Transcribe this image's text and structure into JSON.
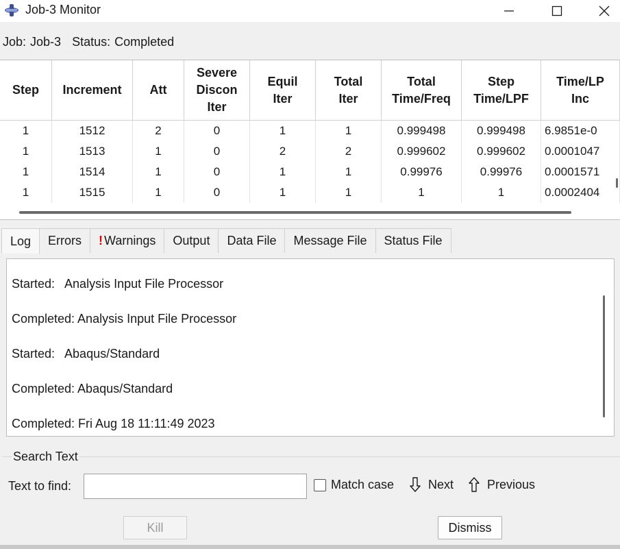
{
  "window": {
    "title": "Job-3 Monitor"
  },
  "job_line": {
    "job_label": "Job:",
    "job_value": "Job-3",
    "status_label": "Status:",
    "status_value": "Completed"
  },
  "table": {
    "headers": [
      "Step",
      "Increment",
      "Att",
      "Severe\nDiscon\nIter",
      "Equil\nIter",
      "Total\nIter",
      "Total\nTime/Freq",
      "Step\nTime/LPF",
      "Time/LP\nInc"
    ],
    "rows": [
      [
        "1",
        "1512",
        "2",
        "0",
        "1",
        "1",
        "0.999498",
        "0.999498",
        "6.9851e-0"
      ],
      [
        "1",
        "1513",
        "1",
        "0",
        "2",
        "2",
        "0.999602",
        "0.999602",
        "0.0001047"
      ],
      [
        "1",
        "1514",
        "1",
        "0",
        "1",
        "1",
        "0.99976",
        "0.99976",
        "0.0001571"
      ],
      [
        "1",
        "1515",
        "1",
        "0",
        "1",
        "1",
        "1",
        "1",
        "0.0002404"
      ]
    ]
  },
  "tabs": [
    {
      "label": "Log",
      "active": true
    },
    {
      "label": "Errors",
      "active": false
    },
    {
      "label": "Warnings",
      "active": false,
      "warning_mark": "!"
    },
    {
      "label": "Output",
      "active": false
    },
    {
      "label": "Data File",
      "active": false
    },
    {
      "label": "Message File",
      "active": false
    },
    {
      "label": "Status File",
      "active": false
    }
  ],
  "log": [
    "Started:   Analysis Input File Processor",
    "Completed: Analysis Input File Processor",
    "Started:   Abaqus/Standard",
    "Completed: Abaqus/Standard",
    "Completed: Fri Aug 18 11:11:49 2023"
  ],
  "search": {
    "legend": "Search Text",
    "find_label": "Text to find:",
    "find_value": "",
    "match_case_label": "Match case",
    "match_case_checked": false,
    "next_label": "Next",
    "previous_label": "Previous"
  },
  "buttons": {
    "kill_label": "Kill",
    "kill_enabled": false,
    "dismiss_label": "Dismiss"
  },
  "colors": {
    "warning": "#e00000",
    "titlebar": "#ffffff",
    "window_bg": "#f0f0f0"
  },
  "icons": {
    "app": "abaqus-app-icon",
    "minimize": "minimize-icon",
    "maximize": "maximize-icon",
    "close": "close-icon",
    "next": "arrow-down-icon",
    "previous": "arrow-up-icon"
  }
}
